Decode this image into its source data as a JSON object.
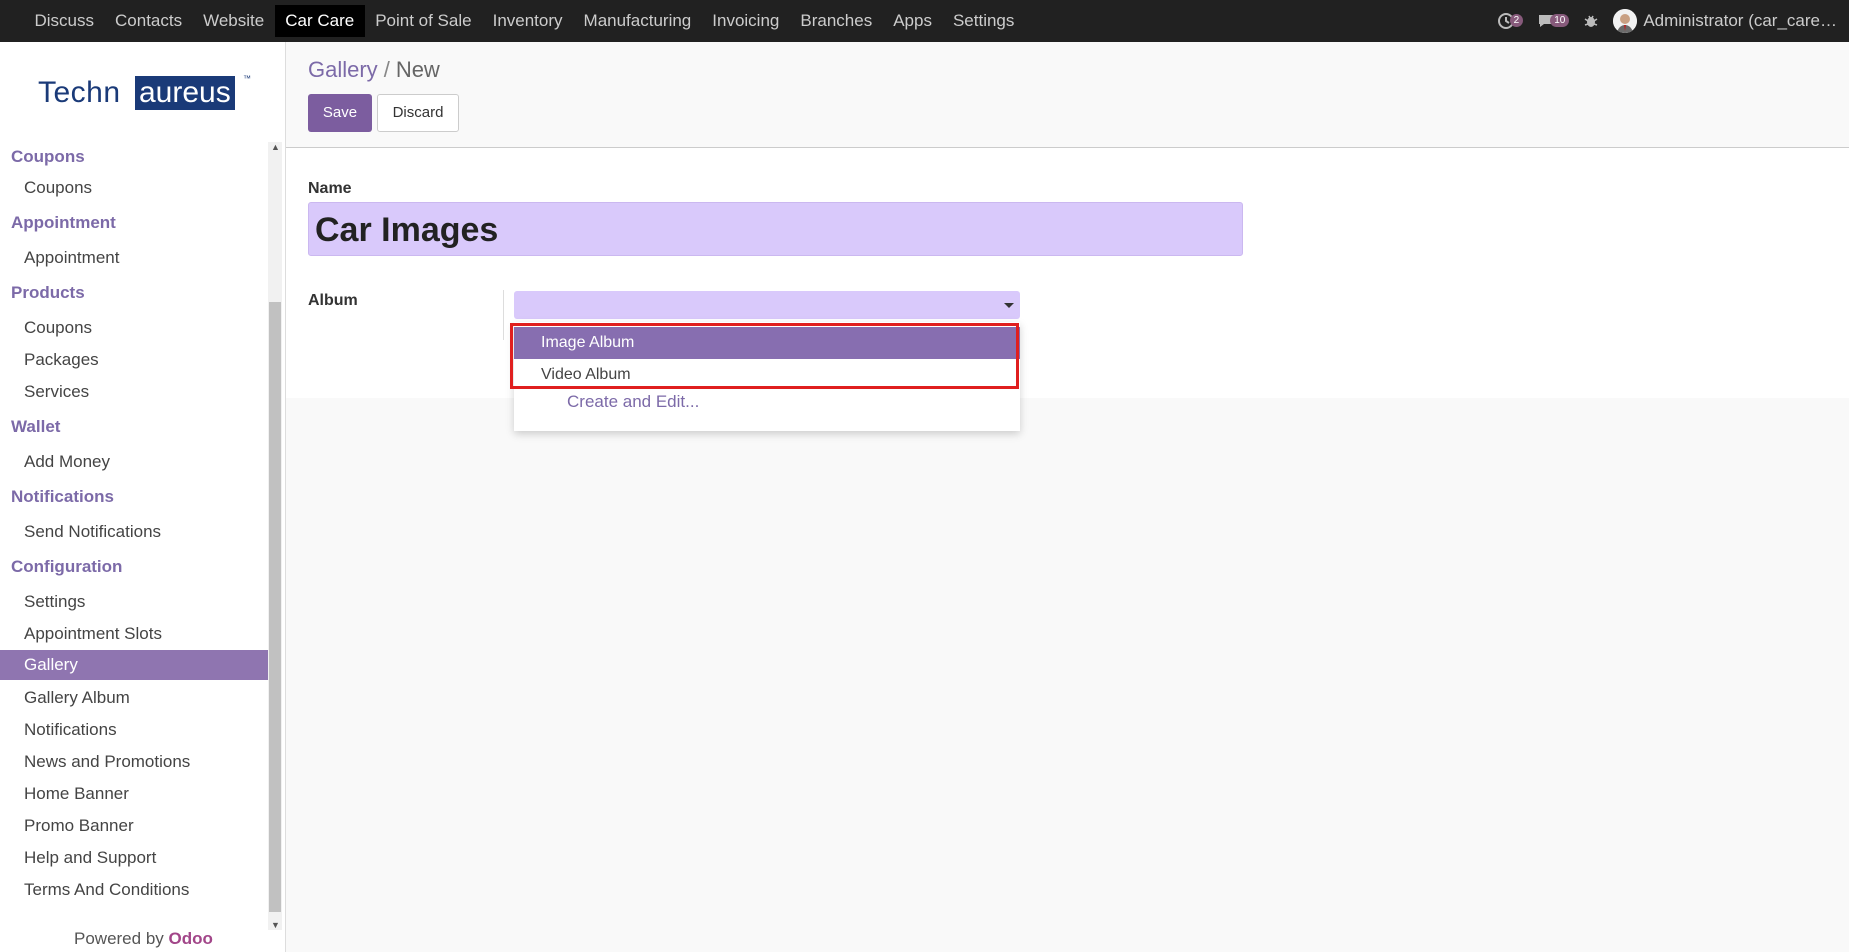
{
  "topbar": {
    "menu": [
      "Discuss",
      "Contacts",
      "Website",
      "Car Care",
      "Point of Sale",
      "Inventory",
      "Manufacturing",
      "Invoicing",
      "Branches",
      "Apps",
      "Settings"
    ],
    "active_menu": "Car Care",
    "activity_count": "2",
    "messages_count": "10",
    "user": "Administrator (car_care…",
    "icons": [
      "activity-icon",
      "chat-icon",
      "bug-icon"
    ]
  },
  "sidebar": {
    "logo": {
      "part1": "Techn",
      "part2": "aureus",
      "tm": "™"
    },
    "sections": [
      {
        "title": "Coupons",
        "items": [
          "Coupons"
        ]
      },
      {
        "title": "Appointment",
        "items": [
          "Appointment"
        ]
      },
      {
        "title": "Products",
        "items": [
          "Coupons",
          "Packages",
          "Services"
        ]
      },
      {
        "title": "Wallet",
        "items": [
          "Add Money"
        ]
      },
      {
        "title": "Notifications",
        "items": [
          "Send Notifications"
        ]
      },
      {
        "title": "Configuration",
        "items": [
          "Settings",
          "Appointment Slots",
          "Gallery",
          "Gallery Album",
          "Notifications",
          "News and Promotions",
          "Home Banner",
          "Promo Banner",
          "Help and Support",
          "Terms And Conditions"
        ]
      }
    ],
    "active_item": "Gallery",
    "powered_by": "Powered by",
    "powered_brand": "Odoo"
  },
  "control_panel": {
    "breadcrumb_parent": "Gallery",
    "breadcrumb_sep": "/",
    "breadcrumb_current": "New",
    "save_label": "Save",
    "discard_label": "Discard"
  },
  "form": {
    "name_label": "Name",
    "name_value": "Car Images",
    "album_label": "Album",
    "album_value": ""
  },
  "dropdown": {
    "options": [
      "Image Album",
      "Video Album"
    ],
    "highlighted": "Image Album",
    "create_label": "Create and Edit..."
  },
  "colors": {
    "accent": "#7c5d9f",
    "highlight": "#876eb0",
    "input_bg": "#d9c9fb",
    "annotation": "#e01f1f"
  }
}
